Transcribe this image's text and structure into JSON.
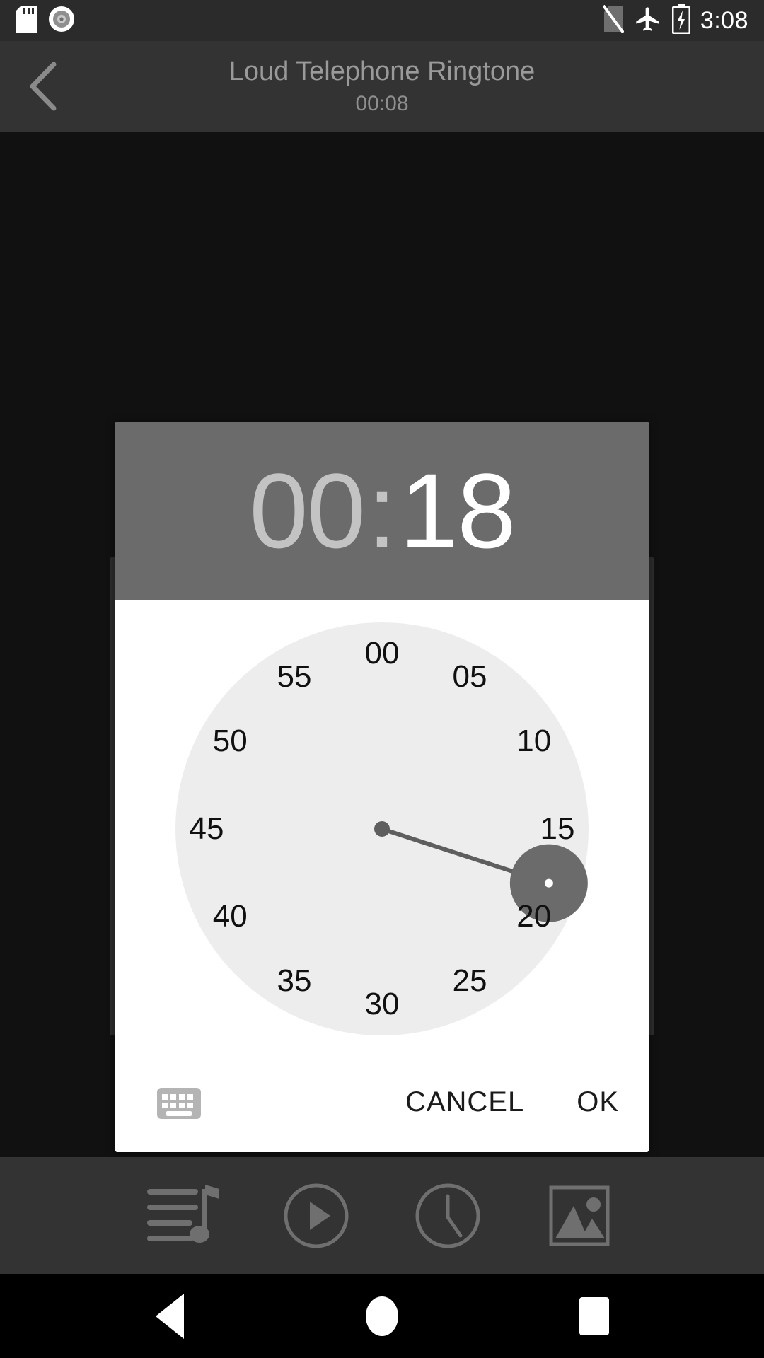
{
  "status_bar": {
    "icons_left": [
      "sd-card-icon",
      "disc-record-icon"
    ],
    "icons_right": [
      "no-sim-icon",
      "airplane-mode-icon",
      "battery-charging-icon"
    ],
    "time": "3:08"
  },
  "title_bar": {
    "back_icon": "chevron-left-icon",
    "title": "Loud Telephone Ringtone",
    "subtitle": "00:08"
  },
  "dialog": {
    "header": {
      "hours": "00",
      "separator": ":",
      "minutes": "18",
      "active_segment": "minutes"
    },
    "clock": {
      "mode": "minutes",
      "selected_value": 18,
      "selected_angle_deg": 108,
      "numbers": [
        "00",
        "05",
        "10",
        "15",
        "20",
        "25",
        "30",
        "35",
        "40",
        "45",
        "50",
        "55"
      ],
      "face_color": "#ededed",
      "hand_color": "#5e5e5e",
      "selector_color": "#6b6b6b"
    },
    "footer": {
      "keyboard_icon": "keyboard-icon",
      "cancel_label": "CANCEL",
      "ok_label": "OK"
    },
    "colors": {
      "header_bg": "#6b6b6b",
      "body_bg": "#ffffff",
      "active_text": "#ffffff",
      "inactive_text": "#c3c3c3"
    }
  },
  "bottom_toolbar": {
    "items": [
      {
        "name": "playlist-music-icon",
        "label": "Playlist"
      },
      {
        "name": "play-circle-icon",
        "label": "Play"
      },
      {
        "name": "clock-icon",
        "label": "Timer"
      },
      {
        "name": "image-icon",
        "label": "Artwork"
      }
    ]
  },
  "nav_bar": {
    "items": [
      {
        "name": "nav-back-icon",
        "label": "Back"
      },
      {
        "name": "nav-home-icon",
        "label": "Home"
      },
      {
        "name": "nav-recents-icon",
        "label": "Recents"
      }
    ]
  }
}
